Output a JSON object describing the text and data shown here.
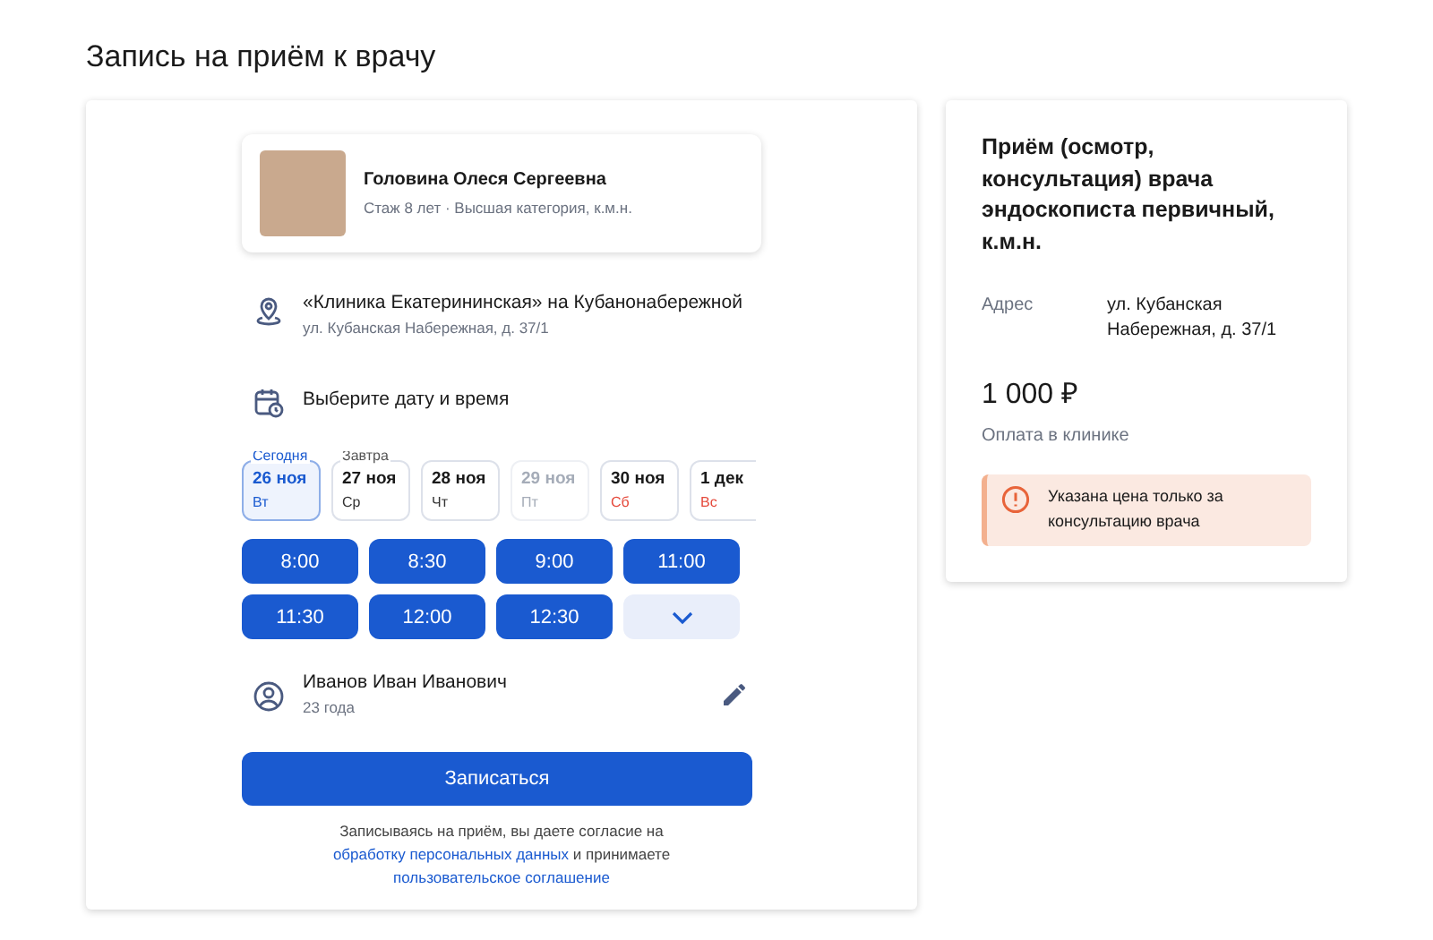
{
  "page_title": "Запись на приём к врачу",
  "doctor": {
    "name": "Головина Олеся Сергеевна",
    "details": "Стаж 8 лет · Высшая категория, к.м.н."
  },
  "clinic": {
    "name": "«Клиника Екатерининская» на Кубанонабережной",
    "address": "ул. Кубанская Набережная, д. 37/1"
  },
  "date_prompt": "Выберите дату и время",
  "dates": [
    {
      "tag": "Сегодня",
      "date": "26 ноя",
      "weekday": "Вт",
      "selected": true,
      "disabled": false,
      "weekend": false
    },
    {
      "tag": "Завтра",
      "date": "27 ноя",
      "weekday": "Ср",
      "selected": false,
      "disabled": false,
      "weekend": false
    },
    {
      "date": "28 ноя",
      "weekday": "Чт",
      "selected": false,
      "disabled": false,
      "weekend": false
    },
    {
      "date": "29 ноя",
      "weekday": "Пт",
      "selected": false,
      "disabled": true,
      "weekend": false
    },
    {
      "date": "30 ноя",
      "weekday": "Сб",
      "selected": false,
      "disabled": false,
      "weekend": true
    },
    {
      "date": "1 дек",
      "weekday": "Вс",
      "selected": false,
      "disabled": false,
      "weekend": true
    }
  ],
  "times": [
    {
      "kind": "time",
      "label": "8:00"
    },
    {
      "kind": "time",
      "label": "8:30"
    },
    {
      "kind": "time",
      "label": "9:00"
    },
    {
      "kind": "time",
      "label": "11:00"
    },
    {
      "kind": "time",
      "label": "11:30"
    },
    {
      "kind": "time",
      "label": "12:00"
    },
    {
      "kind": "time",
      "label": "12:30"
    },
    {
      "kind": "more"
    }
  ],
  "patient": {
    "name": "Иванов Иван Иванович",
    "age": "23 года"
  },
  "submit": "Записаться",
  "consent": {
    "before": "Записываясь на приём, вы даете согласие на",
    "link1": "обработку персональных данных",
    "middle": "и принимаете",
    "link2": "пользовательское соглашение"
  },
  "summary": {
    "service": "Приём (осмотр, консультация) врача эндоскописта первичный, к.м.н.",
    "address_label": "Адрес",
    "address": "ул. Кубанская Набережная, д. 37/1",
    "price": "1 000 ₽",
    "payment": "Оплата в клинике",
    "notice": "Указана цена только за консультацию врача"
  }
}
